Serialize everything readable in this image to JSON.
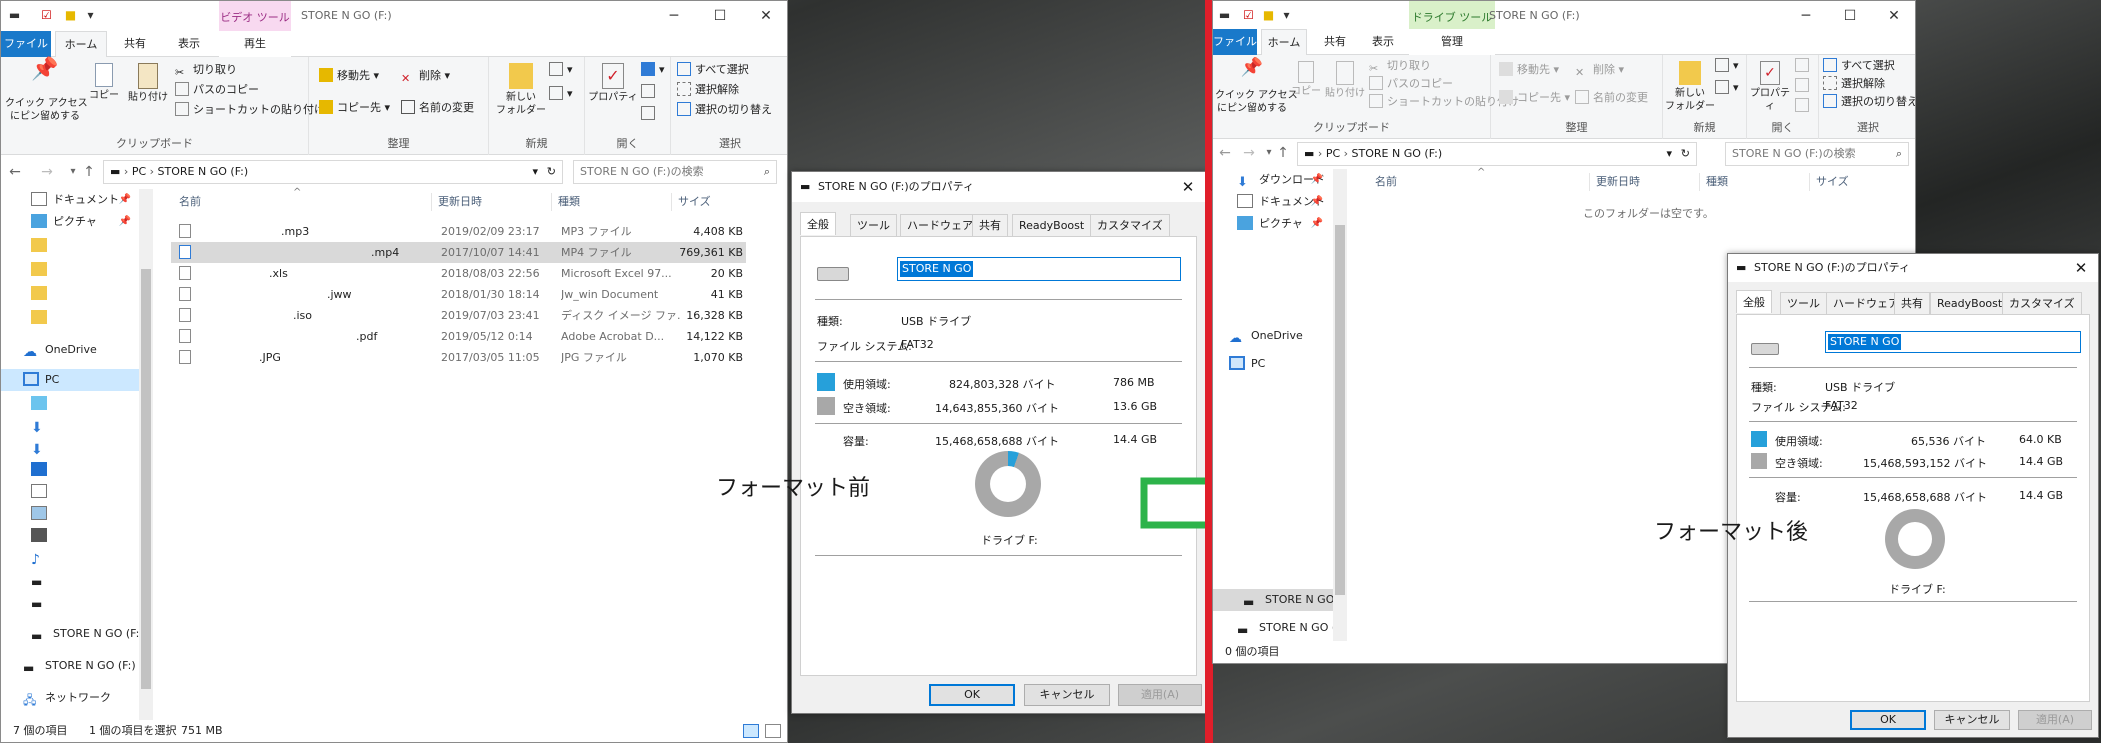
{
  "left_window": {
    "title": "STORE N GO (F:)",
    "context_tab_label": "ビデオ ツール",
    "tabs": [
      "ファイル",
      "ホーム",
      "共有",
      "表示",
      "再生"
    ],
    "ribbon": {
      "quick_access_label": "クイック アクセス\nにピン留めする",
      "copy_label": "コピー",
      "paste_label": "貼り付け",
      "cut_label": "切り取り",
      "copy_path_label": "パスのコピー",
      "paste_shortcut_label": "ショートカットの貼り付け",
      "clipboard_group": "クリップボード",
      "move_to_label": "移動先",
      "delete_label": "削除",
      "copy_to_label": "コピー先",
      "rename_label": "名前の変更",
      "organize_group": "整理",
      "new_folder_label": "新しい\nフォルダー",
      "new_group": "新規",
      "properties_label": "プロパティ",
      "open_group": "開く",
      "select_all_label": "すべて選択",
      "select_none_label": "選択解除",
      "invert_selection_label": "選択の切り替え",
      "select_group": "選択"
    },
    "address": {
      "pc": "PC",
      "drive": "STORE N GO (F:)",
      "search_placeholder": "STORE N GO (F:)の検索"
    },
    "nav": {
      "documents": "ドキュメント",
      "pictures": "ピクチャ",
      "onedrive": "OneDrive",
      "pc": "PC",
      "drive1": "STORE N GO (F:)",
      "drive2": "STORE N GO (F:)",
      "network": "ネットワーク"
    },
    "columns": [
      "名前",
      "更新日時",
      "種類",
      "サイズ"
    ],
    "files": [
      {
        "name": ".mp3",
        "date": "2019/02/09 23:17",
        "type": "MP3 ファイル",
        "size": "4,408 KB"
      },
      {
        "name": ".mp4",
        "date": "2017/10/07 14:41",
        "type": "MP4 ファイル",
        "size": "769,361 KB"
      },
      {
        "name": ".xls",
        "date": "2018/08/03 22:56",
        "type": "Microsoft Excel 97...",
        "size": "20 KB"
      },
      {
        "name": ".jww",
        "date": "2018/01/30 18:14",
        "type": "Jw_win Document",
        "size": "41 KB"
      },
      {
        "name": ".iso",
        "date": "2019/07/03 23:41",
        "type": "ディスク イメージ ファ...",
        "size": "16,328 KB"
      },
      {
        "name": ".pdf",
        "date": "2019/05/12 0:14",
        "type": "Adobe Acrobat D...",
        "size": "14,122 KB"
      },
      {
        "name": ".JPG",
        "date": "2017/03/05 11:05",
        "type": "JPG ファイル",
        "size": "1,070 KB"
      }
    ],
    "status": {
      "count": "7 個の項目",
      "selected": "1 個の項目を選択",
      "size": "751 MB"
    }
  },
  "dialog1": {
    "title": "STORE N GO (F:)のプロパティ",
    "tabs": [
      "全般",
      "ツール",
      "ハードウェア",
      "共有",
      "ReadyBoost",
      "カスタマイズ"
    ],
    "name": "STORE N GO",
    "type_label": "種類:",
    "type_value": "USB ドライブ",
    "fs_label": "ファイル システム:",
    "fs_value": "FAT32",
    "used_label": "使用領域:",
    "used_bytes": "824,803,328 バイト",
    "used_h": "786 MB",
    "free_label": "空き領域:",
    "free_bytes": "14,643,855,360 バイト",
    "free_h": "13.6 GB",
    "cap_label": "容量:",
    "cap_bytes": "15,468,658,688 バイト",
    "cap_h": "14.4 GB",
    "drive_label": "ドライブ F:",
    "used_fraction": 0.0533,
    "ok": "OK",
    "cancel": "キャンセル",
    "apply": "適用(A)"
  },
  "before_label": "フォーマット前",
  "after_label": "フォーマット後",
  "right_window": {
    "title": "STORE N GO (F:)",
    "context_tab_label": "ドライブ ツール",
    "tabs": [
      "ファイル",
      "ホーム",
      "共有",
      "表示",
      "管理"
    ],
    "address": {
      "pc": "PC",
      "drive": "STORE N GO (F:)",
      "search_placeholder": "STORE N GO (F:)の検索"
    },
    "nav": {
      "downloads": "ダウンロード",
      "documents": "ドキュメント",
      "pictures": "ピクチャ",
      "onedrive": "OneDrive",
      "pc": "PC",
      "drive1": "STORE N GO (F:)",
      "drive2": "STORE N GO (F:)"
    },
    "columns": [
      "名前",
      "更新日時",
      "種類",
      "サイズ"
    ],
    "empty_message": "このフォルダーは空です。",
    "status": {
      "count": "0 個の項目"
    }
  },
  "dialog2": {
    "title": "STORE N GO (F:)のプロパティ",
    "tabs": [
      "全般",
      "ツール",
      "ハードウェア",
      "共有",
      "ReadyBoost",
      "カスタマイズ"
    ],
    "name": "STORE N GO",
    "type_label": "種類:",
    "type_value": "USB ドライブ",
    "fs_label": "ファイル システム:",
    "fs_value": "FAT32",
    "used_label": "使用領域:",
    "used_bytes": "65,536 バイト",
    "used_h": "64.0 KB",
    "free_label": "空き領域:",
    "free_bytes": "15,468,593,152 バイト",
    "free_h": "14.4 GB",
    "cap_label": "容量:",
    "cap_bytes": "15,468,658,688 バイト",
    "cap_h": "14.4 GB",
    "drive_label": "ドライブ F:",
    "used_fraction": 0.0,
    "ok": "OK",
    "cancel": "キャンセル",
    "apply": "適用(A)"
  },
  "colors": {
    "used": "#26a0da",
    "free": "#a8a8a8",
    "accent": "#1979ca",
    "divider": "#e01e2a",
    "arrow": "#2db34a"
  }
}
